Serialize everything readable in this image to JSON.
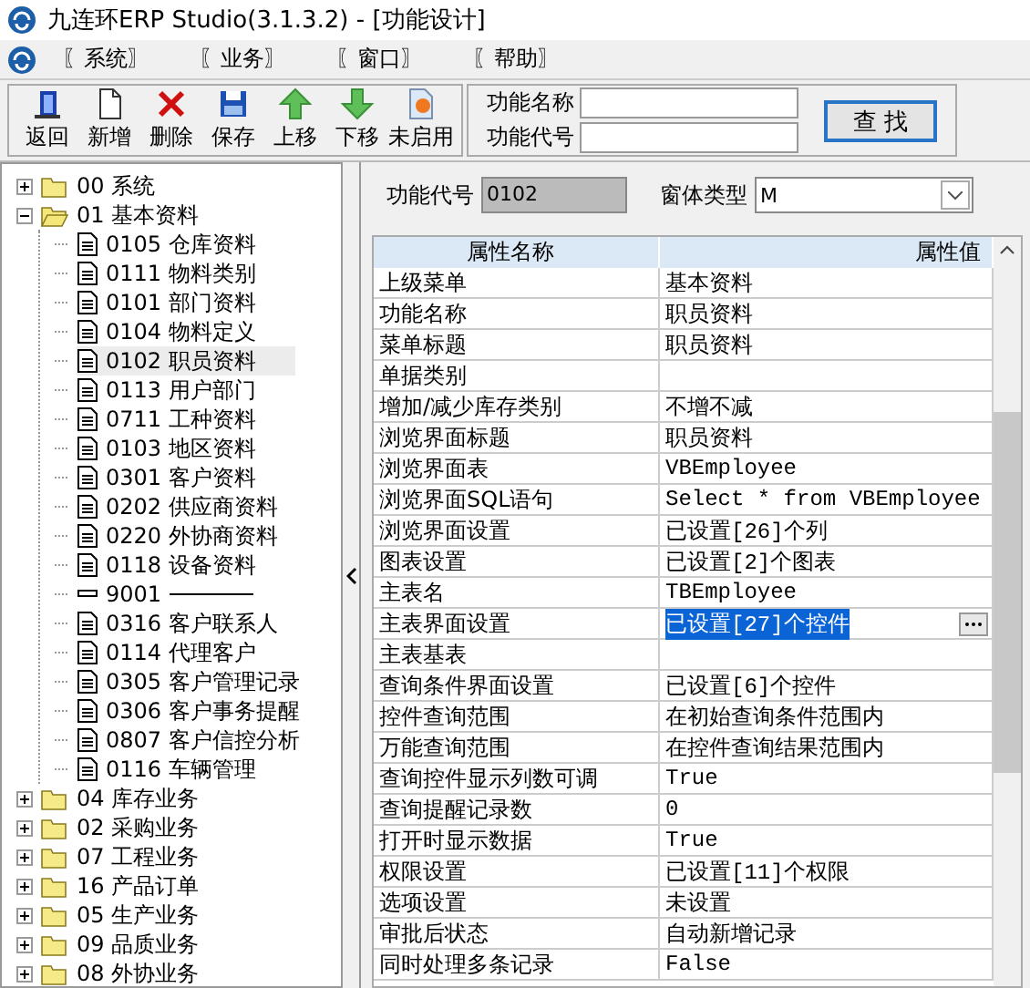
{
  "window": {
    "title": "九连环ERP Studio(3.1.3.2) - [功能设计]"
  },
  "menu": [
    "〖系统〗",
    "〖业务〗",
    "〖窗口〗",
    "〖帮助〗"
  ],
  "toolbar": [
    {
      "label": "返回",
      "kind": "exit"
    },
    {
      "label": "新增",
      "kind": "new"
    },
    {
      "label": "删除",
      "kind": "delete"
    },
    {
      "label": "保存",
      "kind": "save"
    },
    {
      "label": "上移",
      "kind": "up"
    },
    {
      "label": "下移",
      "kind": "down"
    },
    {
      "label": "未启用",
      "kind": "disable"
    }
  ],
  "search": {
    "fields": [
      {
        "label": "功能名称"
      },
      {
        "label": "功能代号"
      }
    ],
    "button": "查 找"
  },
  "tree": [
    {
      "code": "00",
      "label": "系统",
      "kind": "folder",
      "expanded": false,
      "selected": false
    },
    {
      "code": "01",
      "label": "基本资料",
      "kind": "folder",
      "expanded": true,
      "selected": false,
      "children": [
        {
          "code": "0105",
          "label": "仓库资料",
          "kind": "doc",
          "selected": false
        },
        {
          "code": "0111",
          "label": "物料类别",
          "kind": "doc",
          "selected": false
        },
        {
          "code": "0101",
          "label": "部门资料",
          "kind": "doc",
          "selected": false
        },
        {
          "code": "0104",
          "label": "物料定义",
          "kind": "doc",
          "selected": false
        },
        {
          "code": "0102",
          "label": "职员资料",
          "kind": "doc",
          "selected": true
        },
        {
          "code": "0113",
          "label": "用户部门",
          "kind": "doc",
          "selected": false
        },
        {
          "code": "0711",
          "label": "工种资料",
          "kind": "doc",
          "selected": false
        },
        {
          "code": "0103",
          "label": "地区资料",
          "kind": "doc",
          "selected": false
        },
        {
          "code": "0301",
          "label": "客户资料",
          "kind": "doc",
          "selected": false
        },
        {
          "code": "0202",
          "label": "供应商资料",
          "kind": "doc",
          "selected": false
        },
        {
          "code": "0220",
          "label": "外协商资料",
          "kind": "doc",
          "selected": false
        },
        {
          "code": "0118",
          "label": "设备资料",
          "kind": "doc",
          "selected": false
        },
        {
          "code": "9001",
          "kind": "separator",
          "selected": false
        },
        {
          "code": "0316",
          "label": "客户联系人",
          "kind": "doc",
          "selected": false
        },
        {
          "code": "0114",
          "label": "代理客户",
          "kind": "doc",
          "selected": false
        },
        {
          "code": "0305",
          "label": "客户管理记录",
          "kind": "doc",
          "selected": false
        },
        {
          "code": "0306",
          "label": "客户事务提醒",
          "kind": "doc",
          "selected": false
        },
        {
          "code": "0807",
          "label": "客户信控分析",
          "kind": "doc",
          "selected": false
        },
        {
          "code": "0116",
          "label": "车辆管理",
          "kind": "doc",
          "selected": false
        }
      ]
    },
    {
      "code": "04",
      "label": "库存业务",
      "kind": "folder",
      "expanded": false,
      "selected": false
    },
    {
      "code": "02",
      "label": "采购业务",
      "kind": "folder",
      "expanded": false,
      "selected": false
    },
    {
      "code": "07",
      "label": "工程业务",
      "kind": "folder",
      "expanded": false,
      "selected": false
    },
    {
      "code": "16",
      "label": "产品订单",
      "kind": "folder",
      "expanded": false,
      "selected": false
    },
    {
      "code": "05",
      "label": "生产业务",
      "kind": "folder",
      "expanded": false,
      "selected": false
    },
    {
      "code": "09",
      "label": "品质业务",
      "kind": "folder",
      "expanded": false,
      "selected": false
    },
    {
      "code": "08",
      "label": "外协业务",
      "kind": "folder",
      "expanded": false,
      "selected": false
    }
  ],
  "form": {
    "code_label": "功能代号",
    "code_value": "0102",
    "type_label": "窗体类型",
    "type_value": "M"
  },
  "grid": {
    "columns": [
      "属性名称",
      "属性值"
    ],
    "rows": [
      {
        "name": "上级菜单",
        "value": "基本资料",
        "selected": false
      },
      {
        "name": "功能名称",
        "value": "职员资料",
        "selected": false
      },
      {
        "name": "菜单标题",
        "value": "职员资料",
        "selected": false
      },
      {
        "name": "单据类别",
        "selected": false
      },
      {
        "name": "增加/减少库存类别",
        "value": "不增不减",
        "selected": false
      },
      {
        "name": "浏览界面标题",
        "value": "职员资料",
        "selected": false
      },
      {
        "name": "浏览界面表",
        "value": "VBEmployee",
        "selected": false
      },
      {
        "name": "浏览界面SQL语句",
        "value": "Select * from VBEmployee",
        "selected": false
      },
      {
        "name": "浏览界面设置",
        "value": "已设置[26]个列",
        "selected": false
      },
      {
        "name": "图表设置",
        "value": "已设置[2]个图表",
        "selected": false
      },
      {
        "name": "主表名",
        "value": "TBEmployee",
        "selected": false
      },
      {
        "name": "主表界面设置",
        "value": "已设置[27]个控件",
        "selected": true
      },
      {
        "name": "主表基表",
        "selected": false
      },
      {
        "name": "查询条件界面设置",
        "value": "已设置[6]个控件",
        "selected": false
      },
      {
        "name": "控件查询范围",
        "value": "在初始查询条件范围内",
        "selected": false
      },
      {
        "name": "万能查询范围",
        "value": "在控件查询结果范围内",
        "selected": false
      },
      {
        "name": "查询控件显示列数可调",
        "value": "True",
        "selected": false
      },
      {
        "name": "查询提醒记录数",
        "value": "0",
        "selected": false
      },
      {
        "name": "打开时显示数据",
        "value": "True",
        "selected": false
      },
      {
        "name": "权限设置",
        "value": "已设置[11]个权限",
        "selected": false
      },
      {
        "name": "选项设置",
        "value": "未设置",
        "selected": false
      },
      {
        "name": "审批后状态",
        "value": "自动新增记录",
        "selected": false
      },
      {
        "name": "同时处理多条记录",
        "value": "False",
        "selected": false
      }
    ]
  }
}
